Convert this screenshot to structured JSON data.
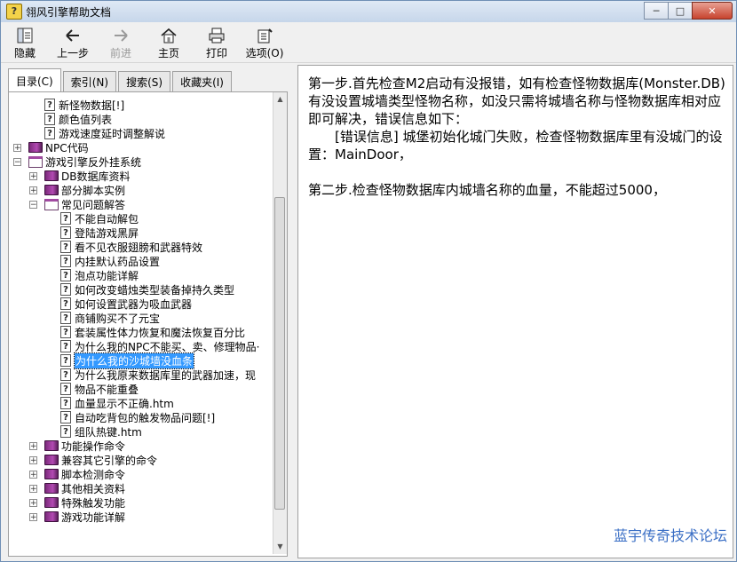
{
  "window": {
    "title": "翎风引擎帮助文档"
  },
  "toolbar": {
    "hide": "隐藏",
    "back": "上一步",
    "forward": "前进",
    "home": "主页",
    "print": "打印",
    "options": "选项(O)"
  },
  "tabs": [
    "目录(C)",
    "索引(N)",
    "搜索(S)",
    "收藏夹(I)"
  ],
  "tree": [
    {
      "label": "新怪物数据[!]",
      "icon": "q"
    },
    {
      "label": "颜色值列表",
      "icon": "q"
    },
    {
      "label": "游戏速度延时调整解说",
      "icon": "q"
    },
    {
      "label": "NPC代码",
      "icon": "book"
    },
    {
      "label": "游戏引擎反外挂系统",
      "icon": "book-open"
    },
    {
      "label": "DB数据库资料",
      "icon": "book"
    },
    {
      "label": "部分脚本实例",
      "icon": "book"
    },
    {
      "label": "常见问题解答",
      "icon": "book-open"
    },
    {
      "label": "不能自动解包",
      "icon": "q"
    },
    {
      "label": "登陆游戏黑屏",
      "icon": "q"
    },
    {
      "label": "看不见衣服翅膀和武器特效",
      "icon": "q"
    },
    {
      "label": "内挂默认药品设置",
      "icon": "q"
    },
    {
      "label": "泡点功能详解",
      "icon": "q"
    },
    {
      "label": "如何改变蜡烛类型装备掉持久类型",
      "icon": "q"
    },
    {
      "label": "如何设置武器为吸血武器",
      "icon": "q"
    },
    {
      "label": "商铺购买不了元宝",
      "icon": "q"
    },
    {
      "label": "套装属性体力恢复和魔法恢复百分比",
      "icon": "q"
    },
    {
      "label": "为什么我的NPC不能买、卖、修理物品·",
      "icon": "q"
    },
    {
      "label": "为什么我的沙城墙没血条",
      "icon": "q"
    },
    {
      "label": "为什么我原来数据库里的武器加速，现",
      "icon": "q"
    },
    {
      "label": "物品不能重叠",
      "icon": "q"
    },
    {
      "label": "血量显示不正确.htm",
      "icon": "q"
    },
    {
      "label": "自动吃背包的触发物品问题[!]",
      "icon": "q"
    },
    {
      "label": "组队热键.htm",
      "icon": "q"
    },
    {
      "label": "功能操作命令",
      "icon": "book"
    },
    {
      "label": "兼容其它引擎的命令",
      "icon": "book"
    },
    {
      "label": "脚本检测命令",
      "icon": "book"
    },
    {
      "label": "其他相关资料",
      "icon": "book"
    },
    {
      "label": "特殊触发功能",
      "icon": "book"
    },
    {
      "label": "游戏功能详解",
      "icon": "book"
    }
  ],
  "content": {
    "para1": "第一步.首先检查M2启动有没报错，如有检查怪物数据库(Monster.DB)有没设置城墙类型怪物名称，如没只需将城墙名称与怪物数据库相对应即可解决，错误信息如下：",
    "para2": "[错误信息] 城堡初始化城门失败，检查怪物数据库里有没城门的设置：MainDoor，",
    "para3": "第二步.检查怪物数据库内城墙名称的血量，不能超过5000，"
  },
  "watermark": "蓝宇传奇技术论坛"
}
